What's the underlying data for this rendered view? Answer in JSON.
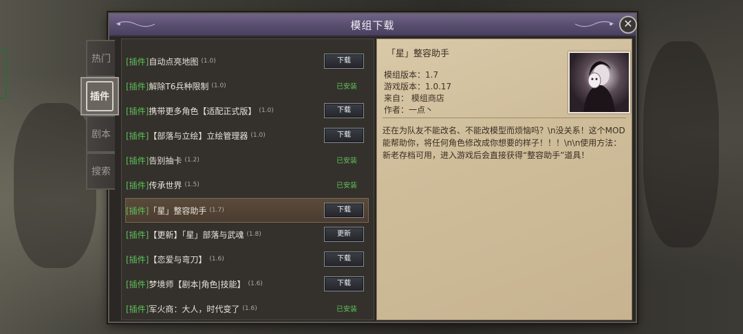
{
  "dialog": {
    "title": "模组下载",
    "close_glyph": "✕"
  },
  "tabs": [
    {
      "label": "热门"
    },
    {
      "label": "插件",
      "active": true
    },
    {
      "label": "剧本"
    },
    {
      "label": "搜索"
    }
  ],
  "mods": [
    {
      "tag": "[插件]",
      "name": "自动点亮地图",
      "version": "(1.0)",
      "action": "下载"
    },
    {
      "tag": "[插件]",
      "name": "解除T6兵种限制",
      "version": "(1.0)",
      "status": "已安装"
    },
    {
      "tag": "[插件]",
      "name": "携带更多角色【适配正式版】",
      "version": "(1.0)",
      "action": "下载"
    },
    {
      "tag": "[插件]",
      "name": "【部落与立绘】立绘管理器",
      "version": "(1.0)",
      "action": "下载"
    },
    {
      "tag": "[插件]",
      "name": "告别抽卡",
      "version": "(1.2)",
      "status": "已安装"
    },
    {
      "tag": "[插件]",
      "name": "传承世界",
      "version": "(1.5)",
      "status": "已安装"
    },
    {
      "tag": "[插件]",
      "name": "「星」整容助手",
      "version": "(1.7)",
      "action": "下载",
      "selected": true
    },
    {
      "tag": "[插件]",
      "name": "【更新】「星」部落与武魂",
      "version": "(1.8)",
      "action": "更新"
    },
    {
      "tag": "[插件]",
      "name": "【恋爱与弯刀】",
      "version": "(1.6)",
      "action": "下载"
    },
    {
      "tag": "[插件]",
      "name": "梦境师【剧本|角色|技能】",
      "version": "(1.6)",
      "action": "下载"
    },
    {
      "tag": "[插件]",
      "name": "军火商：大人，时代变了",
      "version": "(1.6)",
      "status": "已安装"
    }
  ],
  "detail": {
    "title": "「星」整容助手",
    "mod_version": "模组版本：1.7",
    "game_version": "游戏版本：1.0.17",
    "source": "来自：  模组商店",
    "author": "作者：一点丶",
    "description": "还在为队友不能改名、不能改模型而烦恼吗？\\n没关系！这个MOD能帮助你，将任何角色修改成你想要的样子！！！\\n\\n使用方法：新老存档可用，进入游戏后会直接获得“整容助手”道具！"
  },
  "colors": {
    "title_bar": "#5f547a",
    "installed_green": "#5ec45a",
    "parchment": "#d2c19e"
  }
}
